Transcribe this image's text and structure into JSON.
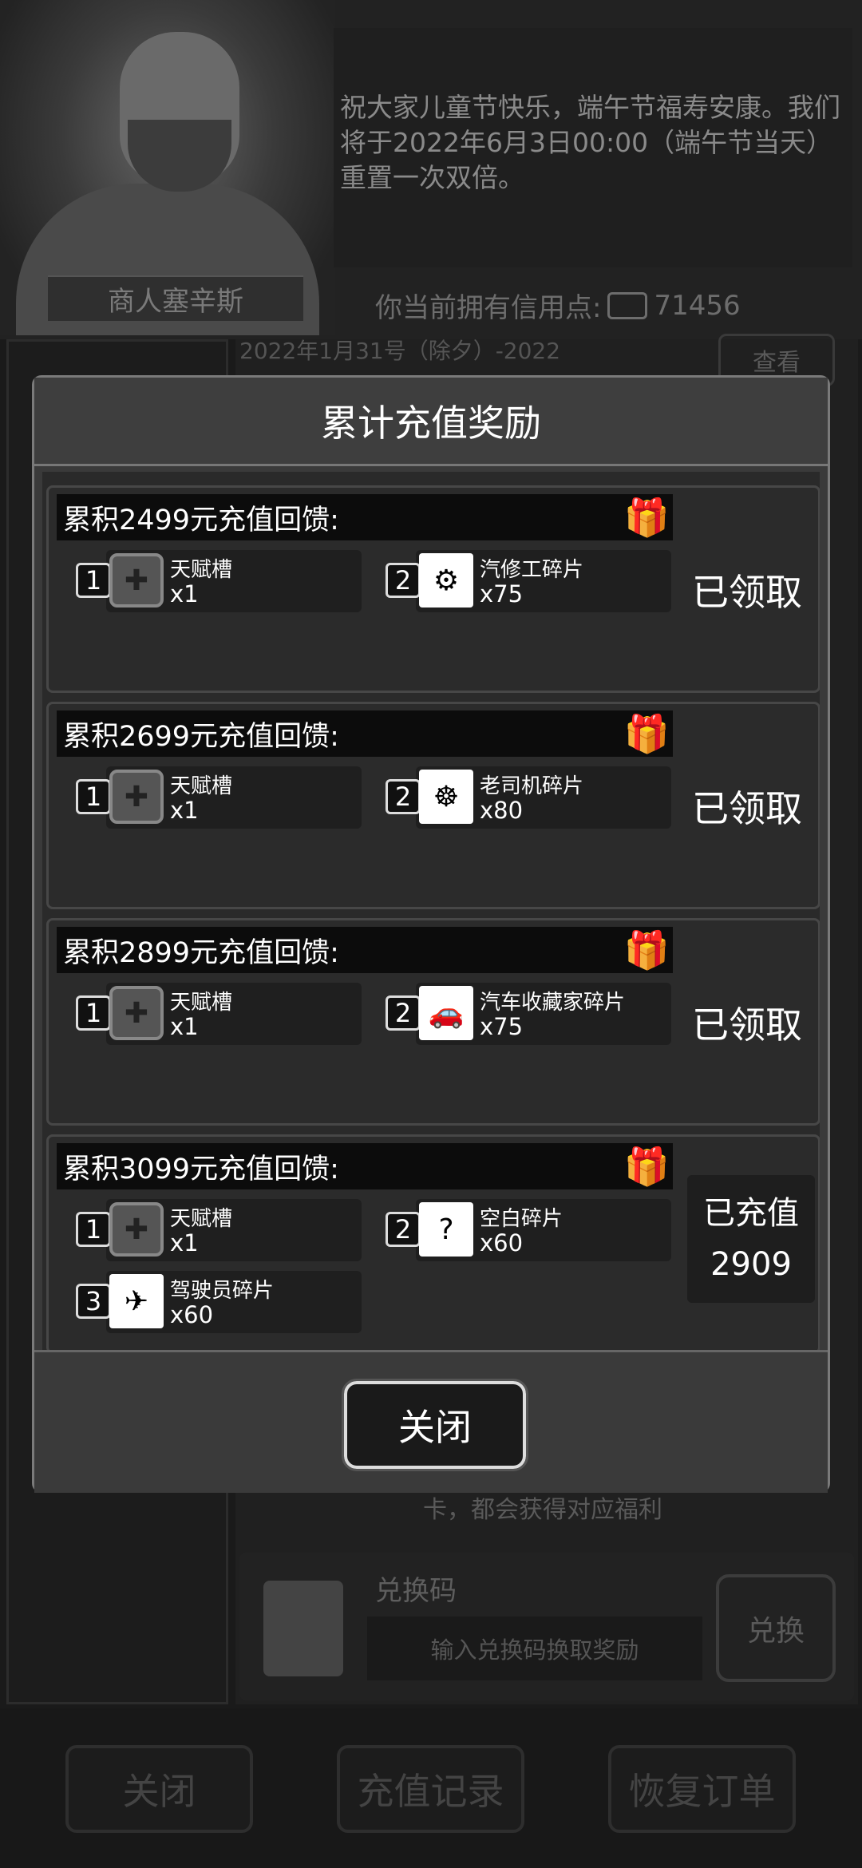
{
  "background": {
    "merchant_name": "商人塞辛斯",
    "notice": "祝大家儿童节快乐，端午节福寿安康。我们将于2022年6月3日00:00（端午节当天）重置一次双倍。",
    "credits_label": "你当前拥有信用点:",
    "credits_value": "71456",
    "item_text": "2022年1月31号（除夕）-2022",
    "view_button": "查看",
    "bottom_text": "卡，都会获得对应福利",
    "redeem_title": "兑换码",
    "redeem_placeholder": "输入兑换码换取奖励",
    "redeem_button": "兑换"
  },
  "bottom_buttons": [
    "关闭",
    "充值记录",
    "恢复订单"
  ],
  "dialog": {
    "title": "累计充值奖励",
    "close_label": "关闭",
    "cards": [
      {
        "header": "累积2499元充值回馈:",
        "rewards": [
          {
            "num": "1",
            "name": "天赋槽",
            "count": "x1",
            "icon": "talent-slot-icon"
          },
          {
            "num": "2",
            "name": "汽修工碎片",
            "count": "x75",
            "icon": "puzzle-mechanic-icon"
          }
        ],
        "status": "已领取"
      },
      {
        "header": "累积2699元充值回馈:",
        "rewards": [
          {
            "num": "1",
            "name": "天赋槽",
            "count": "x1",
            "icon": "talent-slot-icon"
          },
          {
            "num": "2",
            "name": "老司机碎片",
            "count": "x80",
            "icon": "puzzle-driver-icon"
          }
        ],
        "status": "已领取"
      },
      {
        "header": "累积2899元充值回馈:",
        "rewards": [
          {
            "num": "1",
            "name": "天赋槽",
            "count": "x1",
            "icon": "talent-slot-icon"
          },
          {
            "num": "2",
            "name": "汽车收藏家碎片",
            "count": "x75",
            "icon": "puzzle-collector-icon"
          }
        ],
        "status": "已领取"
      },
      {
        "header": "累积3099元充值回馈:",
        "rewards": [
          {
            "num": "1",
            "name": "天赋槽",
            "count": "x1",
            "icon": "talent-slot-icon"
          },
          {
            "num": "2",
            "name": "空白碎片",
            "count": "x60",
            "icon": "puzzle-blank-icon"
          },
          {
            "num": "3",
            "name": "驾驶员碎片",
            "count": "x60",
            "icon": "puzzle-pilot-icon"
          }
        ],
        "status_label": "已充值",
        "status_value": "2909"
      }
    ]
  }
}
